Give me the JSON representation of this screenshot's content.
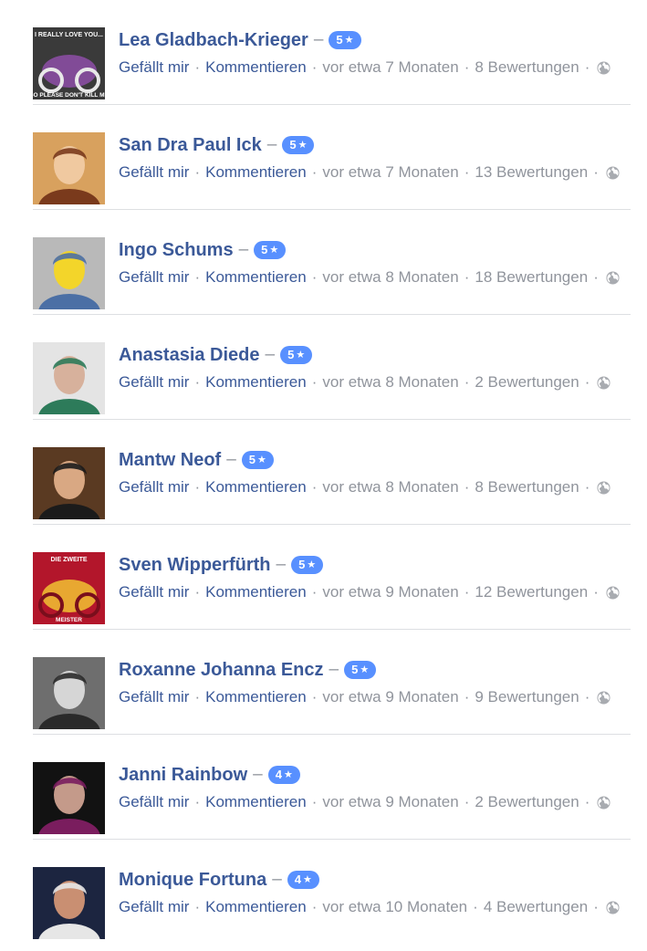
{
  "reviews": [
    {
      "name": "Lea Gladbach-Krieger",
      "rating": "5",
      "like_label": "Gefällt mir",
      "comment_label": "Kommentieren",
      "time": "vor etwa 7 Monaten",
      "rating_count": "8 Bewertungen",
      "avatar": {
        "bg": "#3a3a3a",
        "fg": "#8e4fa8",
        "accent": "#e8e8e8",
        "caption_top": "I REALLY LOVE YOU...",
        "caption_bottom": "SO PLEASE DON'T KILL ME"
      }
    },
    {
      "name": "San Dra Paul Ick",
      "rating": "5",
      "like_label": "Gefällt mir",
      "comment_label": "Kommentieren",
      "time": "vor etwa 7 Monaten",
      "rating_count": "13 Bewertungen",
      "avatar": {
        "bg": "#d8a15e",
        "fg": "#f0c9a0",
        "accent": "#7a3a1c"
      }
    },
    {
      "name": "Ingo Schums",
      "rating": "5",
      "like_label": "Gefällt mir",
      "comment_label": "Kommentieren",
      "time": "vor etwa 8 Monaten",
      "rating_count": "18 Bewertungen",
      "avatar": {
        "bg": "#b9b9b9",
        "fg": "#f3d52a",
        "accent": "#4b6fa5"
      }
    },
    {
      "name": "Anastasia Diede",
      "rating": "5",
      "like_label": "Gefällt mir",
      "comment_label": "Kommentieren",
      "time": "vor etwa 8 Monaten",
      "rating_count": "2 Bewertungen",
      "avatar": {
        "bg": "#e4e4e4",
        "fg": "#d7b19c",
        "accent": "#2d7b5a"
      }
    },
    {
      "name": "Mantw Neof",
      "rating": "5",
      "like_label": "Gefällt mir",
      "comment_label": "Kommentieren",
      "time": "vor etwa 8 Monaten",
      "rating_count": "8 Bewertungen",
      "avatar": {
        "bg": "#5a3a22",
        "fg": "#d9a883",
        "accent": "#1b1b1b"
      }
    },
    {
      "name": "Sven Wipperfürth",
      "rating": "5",
      "like_label": "Gefällt mir",
      "comment_label": "Kommentieren",
      "time": "vor etwa 9 Monaten",
      "rating_count": "12 Bewertungen",
      "avatar": {
        "bg": "#b3162b",
        "fg": "#f1c232",
        "accent": "#7a0e1c",
        "caption_top": "DIE ZWEITE",
        "caption_bottom": "MEISTER"
      }
    },
    {
      "name": "Roxanne Johanna Encz",
      "rating": "5",
      "like_label": "Gefällt mir",
      "comment_label": "Kommentieren",
      "time": "vor etwa 9 Monaten",
      "rating_count": "9 Bewertungen",
      "avatar": {
        "bg": "#6e6e6e",
        "fg": "#d6d6d6",
        "accent": "#2a2a2a"
      }
    },
    {
      "name": "Janni Rainbow",
      "rating": "4",
      "like_label": "Gefällt mir",
      "comment_label": "Kommentieren",
      "time": "vor etwa 9 Monaten",
      "rating_count": "2 Bewertungen",
      "avatar": {
        "bg": "#121212",
        "fg": "#c49a8a",
        "accent": "#7a1d5e"
      }
    },
    {
      "name": "Monique Fortuna",
      "rating": "4",
      "like_label": "Gefällt mir",
      "comment_label": "Kommentieren",
      "time": "vor etwa 10 Monaten",
      "rating_count": "4 Bewertungen",
      "avatar": {
        "bg": "#1c2540",
        "fg": "#c98f72",
        "accent": "#e6e6e6"
      }
    }
  ],
  "ui": {
    "dash": "–",
    "separator": "·",
    "star_glyph": "★",
    "icon_name": "globe-icon"
  }
}
